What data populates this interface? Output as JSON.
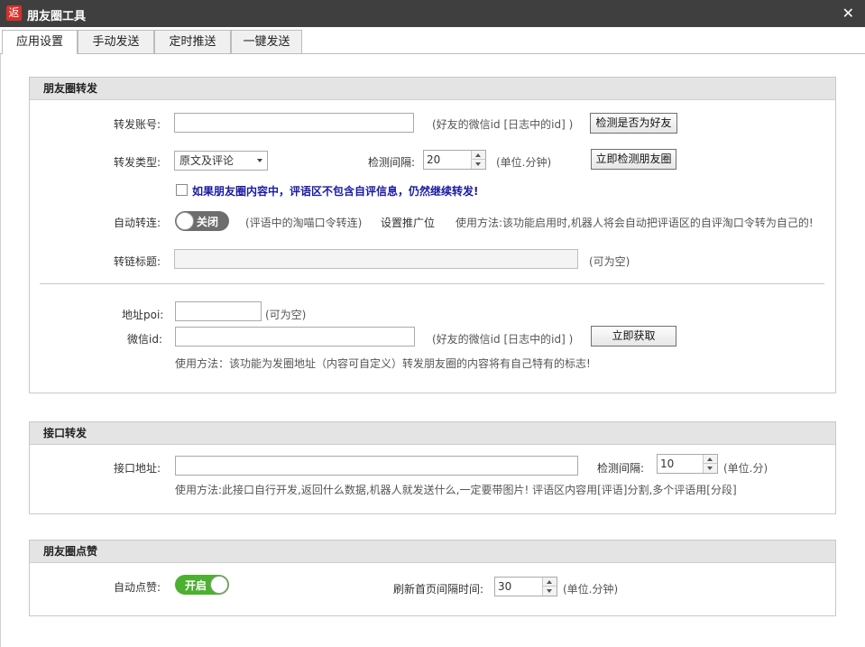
{
  "window": {
    "icon_text": "返",
    "title": "朋友圈工具",
    "close": "✕"
  },
  "tabs": [
    "应用设置",
    "手动发送",
    "定时推送",
    "一键发送"
  ],
  "forward": {
    "heading": "朋友圈转发",
    "account_label": "转发账号:",
    "account_value": "",
    "account_hint": "(好友的微信id [日志中的id] )",
    "check_friend_btn": "检测是否为好友",
    "type_label": "转发类型:",
    "type_value": "原文及评论",
    "interval_label": "检测间隔:",
    "interval_value": "20",
    "interval_unit": "(单位.分钟)",
    "check_now_btn": "立即检测朋友圈",
    "continue_checkbox_label": "如果朋友圈内容中，评语区不包含自评信息，仍然继续转发!",
    "auto_label": "自动转连:",
    "auto_toggle": "关闭",
    "auto_hint": "(评语中的淘喵口令转连)",
    "promo_link": "设置推广位",
    "auto_usage": "使用方法:该功能启用时,机器人将会自动把评语区的自评淘口令转为自己的!",
    "link_title_label": "转链标题:",
    "link_title_value": "",
    "link_title_hint": "(可为空)",
    "poi_label": "地址poi:",
    "poi_value": "",
    "poi_hint": "(可为空)",
    "wxid_label": "微信id:",
    "wxid_value": "",
    "wxid_hint": "(好友的微信id [日志中的id] )",
    "fetch_btn": "立即获取",
    "poi_usage": "使用方法：该功能为发圈地址（内容可自定义）转发朋友圈的内容将有自己特有的标志!"
  },
  "api": {
    "heading": "接口转发",
    "url_label": "接口地址:",
    "url_value": "",
    "interval_label": "检测间隔:",
    "interval_value": "10",
    "interval_unit": "(单位.分)",
    "usage": "使用方法:此接口自行开发,返回什么数据,机器人就发送什么,一定要带图片! 评语区内容用[评语]分割,多个评语用[分段]"
  },
  "like": {
    "heading": "朋友圈点赞",
    "auto_label": "自动点赞:",
    "auto_toggle": "开启",
    "refresh_label": "刷新首页间隔时间:",
    "refresh_value": "30",
    "refresh_unit": "(单位.分钟)"
  }
}
